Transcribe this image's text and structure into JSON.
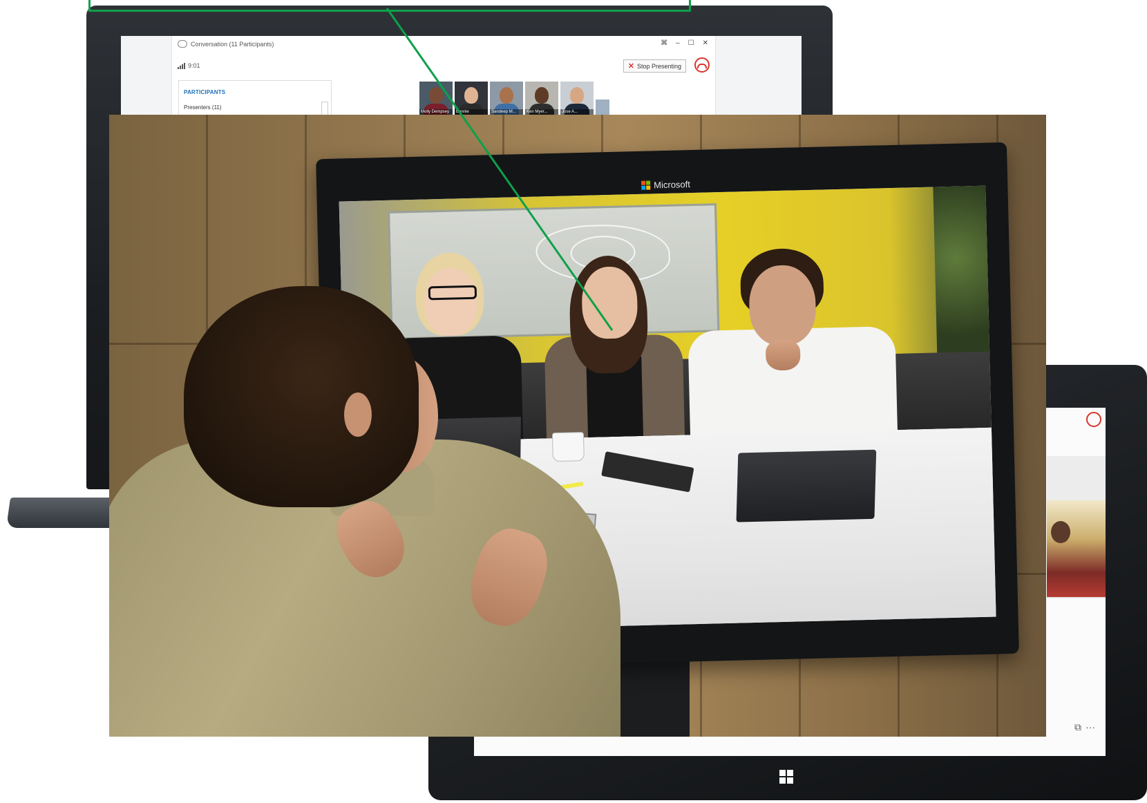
{
  "laptop": {
    "window_title": "Conversation (11 Participants)",
    "time": "9:01",
    "stop_presenting_label": "Stop Presenting",
    "stop_presenting_underline": "t",
    "panel_title": "PARTICIPANTS",
    "presenters_label": "Presenters (11)",
    "window_controls": [
      "⌘",
      "–",
      "☐",
      "✕"
    ],
    "thumbnails": [
      {
        "name": "Molly Dempsey",
        "skin": "#7a4b34",
        "shirt": "#7a1f2b",
        "bg": "#4a5a66"
      },
      {
        "name": "Bonnie",
        "skin": "#e0b393",
        "shirt": "#2a2a2a",
        "bg": "#31343a"
      },
      {
        "name": "Sandeep M...",
        "skin": "#a9714c",
        "shirt": "#3f6fa5",
        "bg": "#8d9aa6"
      },
      {
        "name": "Ken Myer...",
        "skin": "#5e3b26",
        "shirt": "#2e2e2e",
        "bg": "#b8b6b0"
      },
      {
        "name": "Jose A...",
        "skin": "#d7a783",
        "shirt": "#1e2a3a",
        "bg": "#c9ced4"
      }
    ],
    "icons": [
      "conversation-icon",
      "signal-icon",
      "close-icon",
      "end-call-icon"
    ]
  },
  "monitor": {
    "brand": "Microsoft",
    "logo_colors": [
      "#f25022",
      "#7fba00",
      "#00a4ef",
      "#ffb900"
    ]
  },
  "tablet": {
    "tools": [
      "⧉",
      "···"
    ],
    "icons": [
      "end-call-icon",
      "windows-icon"
    ]
  },
  "colors": {
    "callout": "#0ea04a",
    "end_call": "#d9342b",
    "accent_blue": "#1d6fb8"
  }
}
